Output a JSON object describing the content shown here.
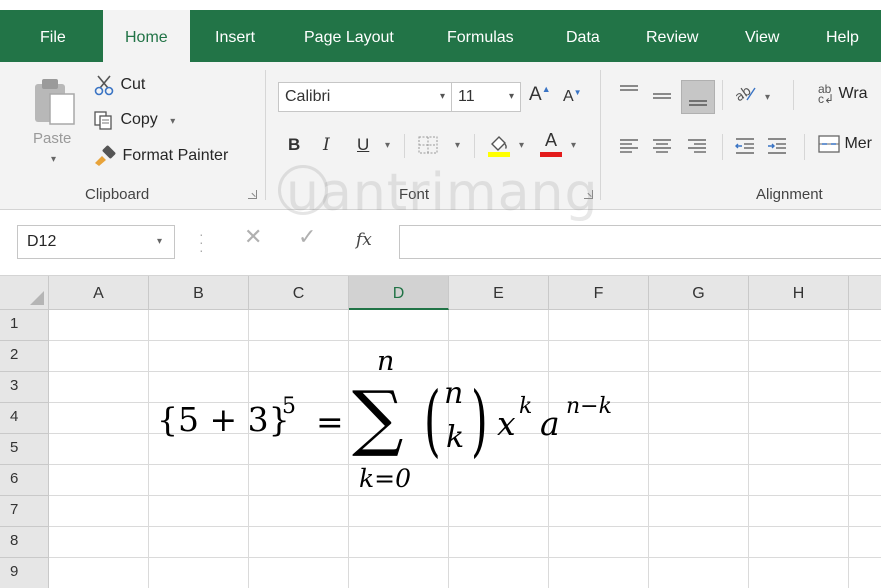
{
  "tabs": [
    {
      "label": "File",
      "active": false
    },
    {
      "label": "Home",
      "active": true
    },
    {
      "label": "Insert",
      "active": false
    },
    {
      "label": "Page Layout",
      "active": false
    },
    {
      "label": "Formulas",
      "active": false
    },
    {
      "label": "Data",
      "active": false
    },
    {
      "label": "Review",
      "active": false
    },
    {
      "label": "View",
      "active": false
    },
    {
      "label": "Help",
      "active": false
    }
  ],
  "clipboard": {
    "paste_label": "Paste",
    "cut_label": "Cut",
    "copy_label": "Copy",
    "format_painter_label": "Format Painter",
    "group_label": "Clipboard"
  },
  "font": {
    "font_name": "Calibri",
    "font_size": "11",
    "group_label": "Font",
    "bold": "B",
    "italic": "I",
    "underline": "U",
    "grow": "A",
    "shrink": "A",
    "font_color_letter": "A"
  },
  "alignment": {
    "wrap_label": "Wra",
    "merge_label": "Mer",
    "group_label": "Alignment"
  },
  "formula_bar": {
    "name_box": "D12",
    "fx_label": "fx",
    "cancel_symbol": "✕",
    "enter_symbol": "✓",
    "formula_value": ""
  },
  "grid": {
    "columns": [
      "A",
      "B",
      "C",
      "D",
      "E",
      "F",
      "G",
      "H"
    ],
    "selected_column": "D",
    "rows": [
      "1",
      "2",
      "3",
      "4",
      "5",
      "6",
      "7",
      "8",
      "9"
    ]
  },
  "equation": {
    "lhs": "{5 + 3}",
    "lhs_exp": "5",
    "equals": "=",
    "sigma": "∑",
    "sum_upper": "n",
    "sum_lower": "k=0",
    "binom_top": "n",
    "binom_bottom": "k",
    "x": "x",
    "x_exp": "k",
    "a": "a",
    "a_exp": "n−k"
  },
  "watermark": "uantrimang",
  "colors": {
    "excel_green": "#217346",
    "tab_bar": "#227447",
    "ribbon_bg": "#f3f3f3",
    "header_bg": "#e6e6e6",
    "gridline": "#dadada",
    "highlight_yellow": "#ffff00",
    "font_red": "#e31b1b"
  }
}
